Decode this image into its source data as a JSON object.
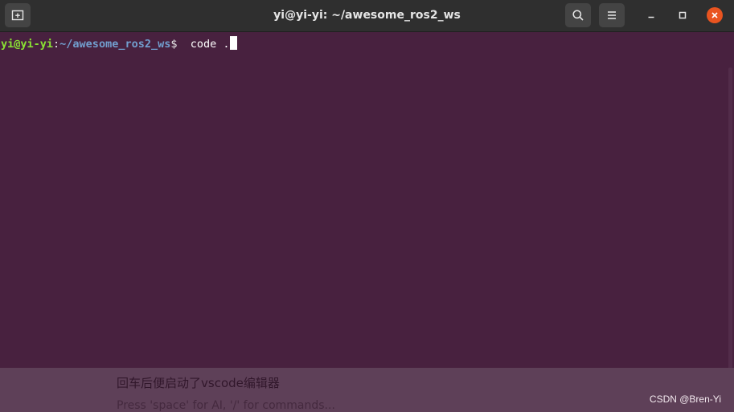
{
  "window": {
    "title": "yi@yi-yi: ~/awesome_ros2_ws",
    "close_color": "#e95420"
  },
  "terminal": {
    "background": "#48213f",
    "prompt_user": "yi@yi-yi",
    "prompt_colon": ":",
    "prompt_path": "~/awesome_ros2_ws",
    "prompt_symbol": "$",
    "command": "code ."
  },
  "caption": {
    "text": "回车后便启动了vscode编辑器",
    "hint": "Press 'space' for AI, '/' for commands..."
  },
  "watermark": "CSDN @Bren-Yi",
  "icons": [
    "new-tab-icon",
    "search-icon",
    "hamburger-menu-icon",
    "minimize-icon",
    "maximize-icon",
    "close-icon"
  ]
}
